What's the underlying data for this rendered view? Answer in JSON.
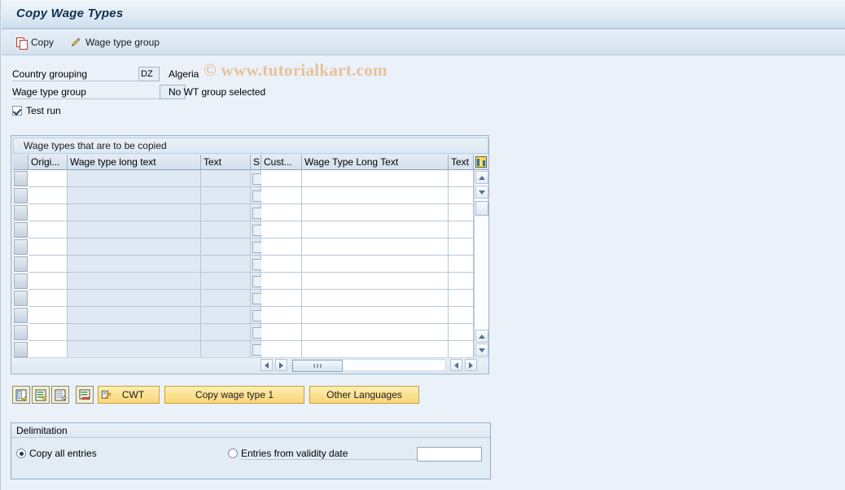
{
  "window": {
    "title": "Copy Wage Types",
    "watermark": "© www.tutorialkart.com"
  },
  "toolbar": {
    "copy_label": "Copy",
    "copy_icon": "copy-icon",
    "wage_type_group_label": "Wage type group",
    "wage_type_group_icon": "pencil-icon"
  },
  "form": {
    "country_grouping": {
      "label": "Country grouping",
      "value": "DZ",
      "description": "Algeria"
    },
    "wage_type_group": {
      "label": "Wage type group",
      "value": "",
      "description": "No WT group selected"
    },
    "test_run": {
      "label": "Test run",
      "checked": true
    }
  },
  "table": {
    "caption": "Wage types that are to be copied",
    "columns": [
      {
        "label": "",
        "key": "select"
      },
      {
        "label": "Origi...",
        "key": "origin"
      },
      {
        "label": "Wage type long text",
        "key": "wt_long_text"
      },
      {
        "label": "Text",
        "key": "text1"
      },
      {
        "label": "S",
        "key": "s"
      },
      {
        "label": "Cust...",
        "key": "cust"
      },
      {
        "label": "Wage Type Long Text",
        "key": "wt_long_text2"
      },
      {
        "label": "Text",
        "key": "text2"
      }
    ],
    "settings_icon": "table-settings-icon",
    "row_count": 11,
    "rows": [
      {
        "origin": "",
        "wt_long_text": "",
        "text1": "",
        "s": "",
        "cust": "",
        "wt_long_text2": "",
        "text2": ""
      },
      {
        "origin": "",
        "wt_long_text": "",
        "text1": "",
        "s": "",
        "cust": "",
        "wt_long_text2": "",
        "text2": ""
      },
      {
        "origin": "",
        "wt_long_text": "",
        "text1": "",
        "s": "",
        "cust": "",
        "wt_long_text2": "",
        "text2": ""
      },
      {
        "origin": "",
        "wt_long_text": "",
        "text1": "",
        "s": "",
        "cust": "",
        "wt_long_text2": "",
        "text2": ""
      },
      {
        "origin": "",
        "wt_long_text": "",
        "text1": "",
        "s": "",
        "cust": "",
        "wt_long_text2": "",
        "text2": ""
      },
      {
        "origin": "",
        "wt_long_text": "",
        "text1": "",
        "s": "",
        "cust": "",
        "wt_long_text2": "",
        "text2": ""
      },
      {
        "origin": "",
        "wt_long_text": "",
        "text1": "",
        "s": "",
        "cust": "",
        "wt_long_text2": "",
        "text2": ""
      },
      {
        "origin": "",
        "wt_long_text": "",
        "text1": "",
        "s": "",
        "cust": "",
        "wt_long_text2": "",
        "text2": ""
      },
      {
        "origin": "",
        "wt_long_text": "",
        "text1": "",
        "s": "",
        "cust": "",
        "wt_long_text2": "",
        "text2": ""
      },
      {
        "origin": "",
        "wt_long_text": "",
        "text1": "",
        "s": "",
        "cust": "",
        "wt_long_text2": "",
        "text2": ""
      },
      {
        "origin": "",
        "wt_long_text": "",
        "text1": "",
        "s": "",
        "cust": "",
        "wt_long_text2": "",
        "text2": ""
      }
    ]
  },
  "actions": {
    "icon_buttons": [
      {
        "name": "select-all-icon-button",
        "icon": "select-entries-icon"
      },
      {
        "name": "select-block-icon-button",
        "icon": "select-block-icon"
      },
      {
        "name": "deselect-icon-button",
        "icon": "deselect-entries-icon"
      },
      {
        "name": "delete-entry-icon-button",
        "icon": "delete-row-icon"
      }
    ],
    "cwt": {
      "label": "CWT",
      "icon": "cwt-icon"
    },
    "copy_wage_type_1": {
      "label": "Copy wage type 1"
    },
    "other_languages": {
      "label": "Other Languages"
    }
  },
  "delimitation": {
    "title": "Delimitation",
    "copy_all": {
      "label": "Copy all entries",
      "selected": true
    },
    "from_validity": {
      "label": "Entries from validity date",
      "selected": false
    },
    "validity_date_value": ""
  },
  "colors": {
    "accent": "#f9d87c",
    "panel_bg": "#e2ecf5",
    "page_bg": "#eaf1f8",
    "watermark": "#e7b98a",
    "grid_blue_cell": "#dfe9f3"
  }
}
